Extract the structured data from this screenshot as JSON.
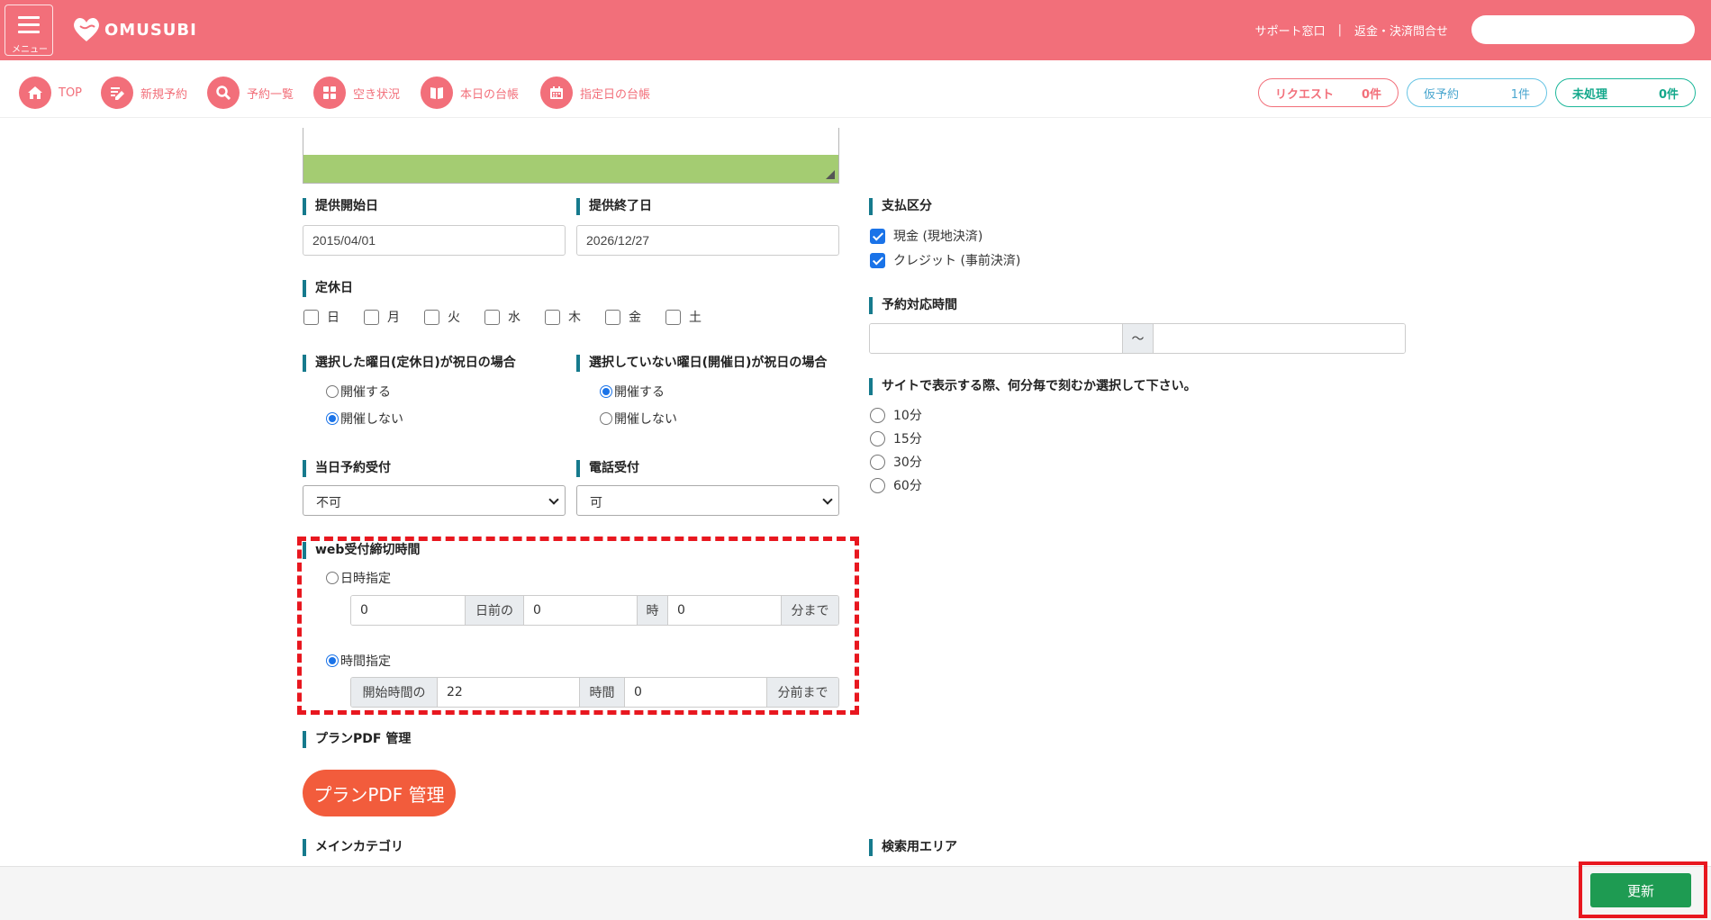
{
  "header": {
    "menu_label": "メニュー",
    "logo_text": "OMUSUBI",
    "links": [
      "サポート窓口",
      "返金・決済問合せ"
    ],
    "separator": "|",
    "search_placeholder": ""
  },
  "nav": {
    "items": [
      {
        "label": "TOP",
        "icon": "home-icon"
      },
      {
        "label": "新規予約",
        "icon": "edit-icon"
      },
      {
        "label": "予約一覧",
        "icon": "search-icon"
      },
      {
        "label": "空き状況",
        "icon": "grid-icon"
      },
      {
        "label": "本日の台帳",
        "icon": "book-icon"
      },
      {
        "label": "指定日の台帳",
        "icon": "calendar-icon"
      }
    ],
    "counters": [
      {
        "label": "リクエスト",
        "count": "0件",
        "color": "#f26f7a"
      },
      {
        "label": "仮予約",
        "count": "1件",
        "color": "#49a6cf"
      },
      {
        "label": "未処理",
        "count": "0件",
        "color": "#13a88b"
      }
    ]
  },
  "form": {
    "start_date": {
      "label": "提供開始日",
      "value": "2015/04/01"
    },
    "end_date": {
      "label": "提供終了日",
      "value": "2026/12/27"
    },
    "payment": {
      "label": "支払区分",
      "options": [
        {
          "label": "現金 (現地決済)",
          "checked": true
        },
        {
          "label": "クレジット (事前決済)",
          "checked": true
        }
      ]
    },
    "holidays": {
      "label": "定休日",
      "days": [
        "日",
        "月",
        "火",
        "水",
        "木",
        "金",
        "土"
      ]
    },
    "reservation_hours": {
      "label": "予約対応時間",
      "from": "",
      "separator": "〜",
      "to": ""
    },
    "holiday_on_closed": {
      "label": "選択した曜日(定休日)が祝日の場合",
      "options": [
        "開催する",
        "開催しない"
      ],
      "selected": "開催しない"
    },
    "holiday_on_open": {
      "label": "選択していない曜日(開催日)が祝日の場合",
      "options": [
        "開催する",
        "開催しない"
      ],
      "selected": "開催する"
    },
    "interval": {
      "label": "サイトで表示する際、何分毎で刻むか選択して下さい。",
      "options": [
        "10分",
        "15分",
        "30分",
        "60分"
      ]
    },
    "same_day": {
      "label": "当日予約受付",
      "value": "不可"
    },
    "phone": {
      "label": "電話受付",
      "value": "可"
    },
    "web_deadline": {
      "label": "web受付締切時間",
      "date_option": "日時指定",
      "date_fields": {
        "days": "0",
        "days_suffix": "日前の",
        "hour": "0",
        "hour_suffix": "時",
        "minute": "0",
        "minute_suffix": "分まで"
      },
      "time_option": "時間指定",
      "time_fields": {
        "prefix": "開始時間の",
        "hours": "22",
        "hours_suffix": "時間",
        "minutes": "0",
        "minutes_suffix": "分前まで"
      },
      "selected": "時間指定"
    },
    "plan_pdf": {
      "label": "プランPDF 管理",
      "button": "プランPDF 管理"
    },
    "main_category": {
      "label": "メインカテゴリ"
    },
    "search_area": {
      "label": "検索用エリア"
    }
  },
  "footer": {
    "update_button": "更新"
  }
}
